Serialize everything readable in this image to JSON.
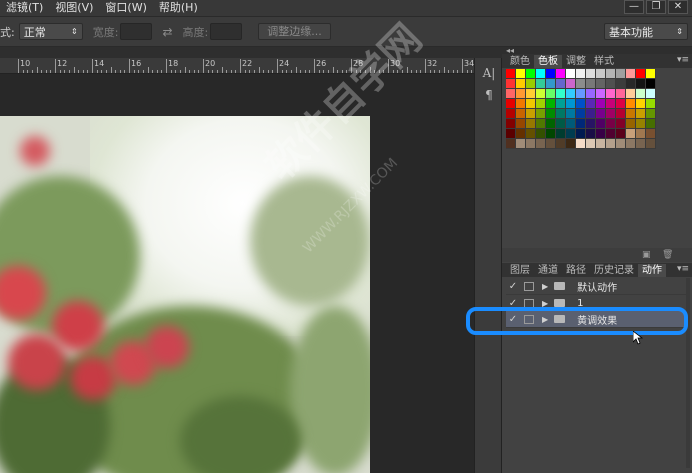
{
  "menubar": {
    "items": [
      "滤镜(T)",
      "视图(V)",
      "窗口(W)",
      "帮助(H)"
    ],
    "window_controls": [
      "—",
      "❐",
      "✕"
    ]
  },
  "options": {
    "style_label": "式:",
    "style_value": "正常",
    "width_label": "宽度:",
    "height_label": "高度:",
    "refine_edge_label": "调整边缘...",
    "workspace_value": "基本功能"
  },
  "ruler": {
    "labels": [
      "10",
      "12",
      "14",
      "16",
      "18",
      "20",
      "22",
      "24",
      "26",
      "28",
      "30",
      "32",
      "34"
    ]
  },
  "swatches_panel": {
    "tabs": [
      "颜色",
      "色板",
      "调整",
      "样式"
    ],
    "active_tab": "色板"
  },
  "actions_panel": {
    "tabs": [
      "图层",
      "通道",
      "路径",
      "历史记录",
      "动作"
    ],
    "active_tab": "动作",
    "rows": [
      {
        "check": "✓",
        "label": "默认动作"
      },
      {
        "check": "✓",
        "label": "1"
      },
      {
        "check": "✓",
        "label": "黄调效果"
      }
    ]
  },
  "watermark": {
    "text": "软件自学网",
    "url": "WWW.RJZXW.COM"
  },
  "colors": {
    "accent_ring": "#1a8cff",
    "panel_bg": "#424242",
    "active_tab_bg": "#4a4a4a"
  },
  "swatch_colors": [
    "#ff0000",
    "#ffff00",
    "#00ff00",
    "#00ffff",
    "#0000ff",
    "#ff00ff",
    "#ffffff",
    "#f0f0f0",
    "#dcdcdc",
    "#c8c8c8",
    "#b4b4b4",
    "#a0a0a0",
    "#ff9999",
    "#ff0000",
    "#ffff00",
    "#ff3333",
    "#ffcc00",
    "#99cc00",
    "#33cc99",
    "#3399cc",
    "#6666cc",
    "#cc66cc",
    "#8c8c8c",
    "#787878",
    "#646464",
    "#505050",
    "#3c3c3c",
    "#282828",
    "#141414",
    "#000000",
    "#ff6666",
    "#ff9933",
    "#ffcc33",
    "#ccff33",
    "#66ff66",
    "#33ffcc",
    "#33ccff",
    "#6699ff",
    "#9966ff",
    "#cc66ff",
    "#ff66cc",
    "#ff6699",
    "#ffcc99",
    "#ccffcc",
    "#ccffff",
    "#e60000",
    "#f07800",
    "#f0c800",
    "#a0d200",
    "#00b400",
    "#00a096",
    "#0096d2",
    "#0050c8",
    "#5a28b4",
    "#a000b4",
    "#c80078",
    "#dc0046",
    "#ff8c00",
    "#ffd200",
    "#96dc00",
    "#b40000",
    "#c86400",
    "#c8a000",
    "#78a000",
    "#008c00",
    "#007864",
    "#0078a0",
    "#003ca0",
    "#3c1e8c",
    "#78008c",
    "#a00064",
    "#b40032",
    "#c87800",
    "#c8a000",
    "#649600",
    "#820000",
    "#964600",
    "#967800",
    "#507800",
    "#006400",
    "#005a46",
    "#005a78",
    "#002878",
    "#281464",
    "#500064",
    "#780046",
    "#820028",
    "#966400",
    "#968200",
    "#466e00",
    "#5a0000",
    "#643000",
    "#645000",
    "#345000",
    "#004600",
    "#003c30",
    "#003c50",
    "#001a50",
    "#1a0e46",
    "#380046",
    "#500030",
    "#5a001a",
    "#c8a07a",
    "#a07850",
    "#785030",
    "#503020",
    "#a08c78",
    "#8c7864",
    "#786450",
    "#64503c",
    "#503c28",
    "#3c2814",
    "#f5dcc8",
    "#dcc8b4",
    "#c8b4a0",
    "#b4a08c",
    "#a08c78",
    "#8c7864",
    "#786450",
    "#64503c"
  ]
}
